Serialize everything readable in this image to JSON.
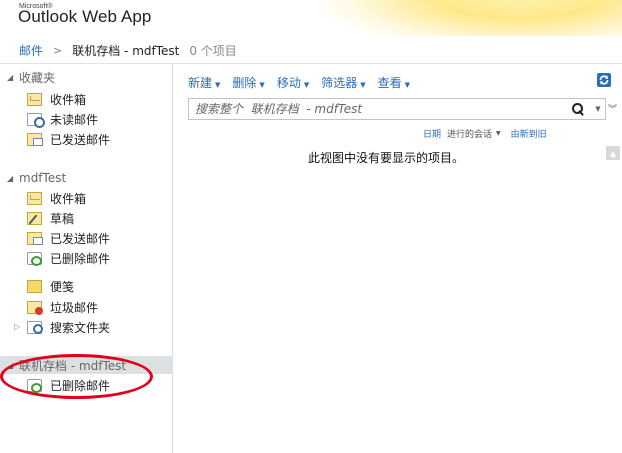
{
  "app": {
    "brand_small": "Microsoft®",
    "title": "Outlook Web App"
  },
  "breadcrumb": {
    "root": "邮件",
    "separator": ">",
    "current": "联机存档 - mdfTest",
    "count": "0 个项目"
  },
  "sidebar": {
    "favorites": {
      "label": "收藏夹",
      "items": [
        {
          "label": "收件箱",
          "icon": "inbox-icon"
        },
        {
          "label": "未读邮件",
          "icon": "unread-search-icon"
        },
        {
          "label": "已发送邮件",
          "icon": "sent-icon"
        }
      ]
    },
    "mailbox": {
      "label": "mdfTest",
      "items": [
        {
          "label": "收件箱",
          "icon": "inbox-icon"
        },
        {
          "label": "草稿",
          "icon": "drafts-icon"
        },
        {
          "label": "已发送邮件",
          "icon": "sent-icon"
        },
        {
          "label": "已删除邮件",
          "icon": "deleted-icon"
        },
        {
          "label": "便笺",
          "icon": "notes-icon"
        },
        {
          "label": "垃圾邮件",
          "icon": "junk-icon"
        },
        {
          "label": "搜索文件夹",
          "icon": "search-folder-icon"
        }
      ]
    },
    "archive": {
      "label": "联机存档 - mdfTest",
      "items": [
        {
          "label": "已删除邮件",
          "icon": "deleted-icon"
        }
      ]
    }
  },
  "toolbar": {
    "new": "新建",
    "delete": "删除",
    "move": "移动",
    "filter": "筛选器",
    "view": "查看"
  },
  "search": {
    "placeholder": "搜索整个  联机存档  - mdfTest"
  },
  "sort": {
    "date": "日期",
    "conversation": "进行的会话",
    "order": "由新到旧"
  },
  "list": {
    "empty_message": "此视图中没有要显示的项目。"
  },
  "colors": {
    "link": "#2a6ebb",
    "annotation": "#e3001b",
    "selected_bg": "#dde0e3"
  }
}
